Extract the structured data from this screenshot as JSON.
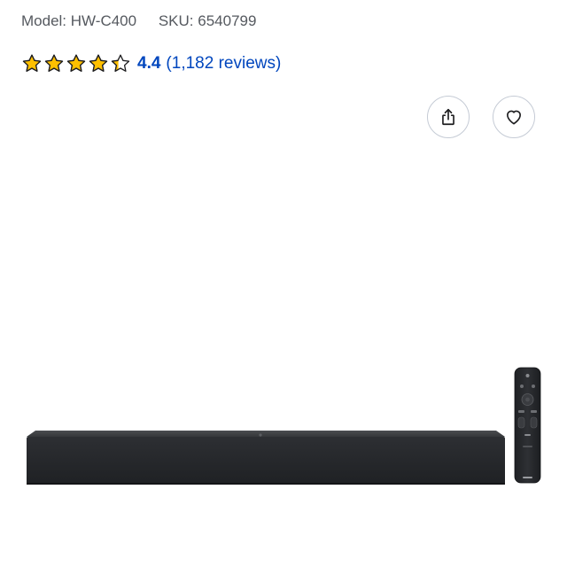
{
  "product": {
    "model_label": "Model:",
    "model_value": "HW-C400",
    "sku_label": "SKU:",
    "sku_value": "6540799"
  },
  "rating": {
    "value": "4.4",
    "reviews_text": "(1,182 reviews)",
    "stars": [
      1,
      1,
      1,
      1,
      0.4
    ],
    "star_color": "#ffc000",
    "star_outline": "#1d1d1f"
  },
  "actions": {
    "share_icon": "share-icon",
    "favorite_icon": "heart-icon"
  },
  "colors": {
    "link": "#0046be",
    "meta_text": "#55595f",
    "soundbar": "#2b2d30",
    "remote": "#2a2c2f"
  },
  "image": {
    "subject": "soundbar-with-remote"
  }
}
